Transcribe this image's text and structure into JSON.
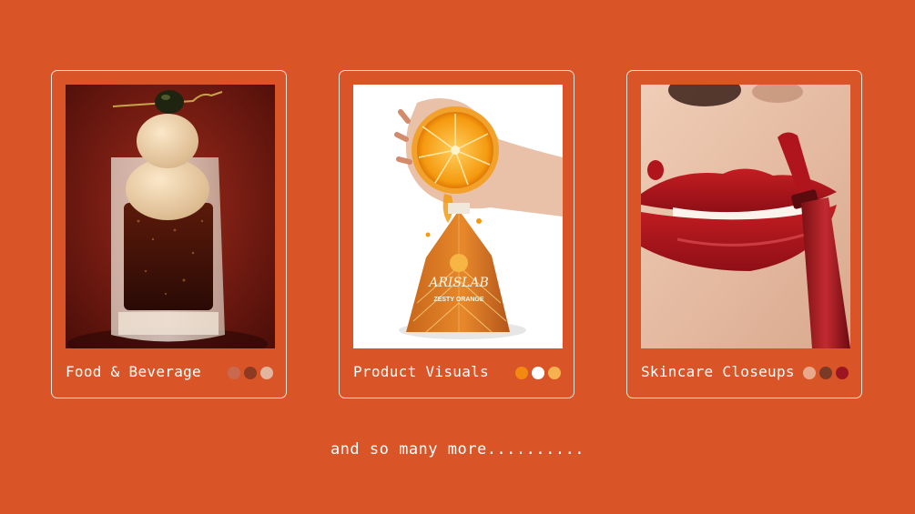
{
  "cards": [
    {
      "label": "Food & Beverage",
      "image": "ice-cream-float-photo",
      "swatches": [
        "#c96a50",
        "#8e3a22",
        "#e2b59e"
      ]
    },
    {
      "label": "Product Visuals",
      "image": "orange-juice-package-photo",
      "swatches": [
        "#f28a12",
        "#ffffff",
        "#f5b24e"
      ]
    },
    {
      "label": "Skincare Closeups",
      "image": "red-lipstick-closeup-photo",
      "swatches": [
        "#e8a98c",
        "#7a3a25",
        "#9b1620"
      ]
    }
  ],
  "product_pack": {
    "brand": "ARISLAB",
    "flavor": "ZESTY ORANGE"
  },
  "tagline": "and so many more.........."
}
